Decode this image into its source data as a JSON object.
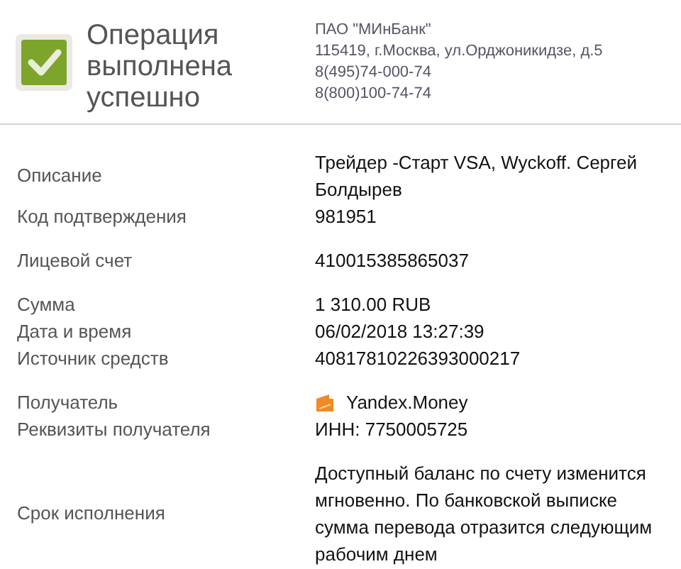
{
  "header": {
    "title": "Операция выполнена успешно",
    "bank": [
      "ПАО \"МИнБанк\"",
      "115419, г.Москва, ул.Орджоникидзе, д.5",
      "8(495)74-000-74",
      "8(800)100-74-74"
    ]
  },
  "groups": [
    {
      "rows": [
        {
          "label": "Описание",
          "value": "Трейдер -Старт VSA, Wyckoff. Сергей Болдырев"
        },
        {
          "label": "Код подтверждения",
          "value": "981951"
        }
      ]
    },
    {
      "rows": [
        {
          "label": "Лицевой счет",
          "value": "410015385865037"
        }
      ]
    },
    {
      "rows": [
        {
          "label": "Сумма",
          "value": "1 310.00 RUB"
        },
        {
          "label": "Дата и время",
          "value": "06/02/2018 13:27:39"
        },
        {
          "label": "Источник средств",
          "value": "40817810226393000217"
        }
      ]
    },
    {
      "rows": [
        {
          "label": "Получатель",
          "value": "Yandex.Money",
          "kind": "wallet"
        },
        {
          "label": "Реквизиты получателя",
          "value": "ИНН: 7750005725"
        }
      ]
    },
    {
      "rows": [
        {
          "label": "Срок исполнения",
          "value": "Доступный баланс по счету изменится мгновенно. По банковской выписке сумма перевода отразится следующим рабочим днем"
        }
      ]
    }
  ]
}
